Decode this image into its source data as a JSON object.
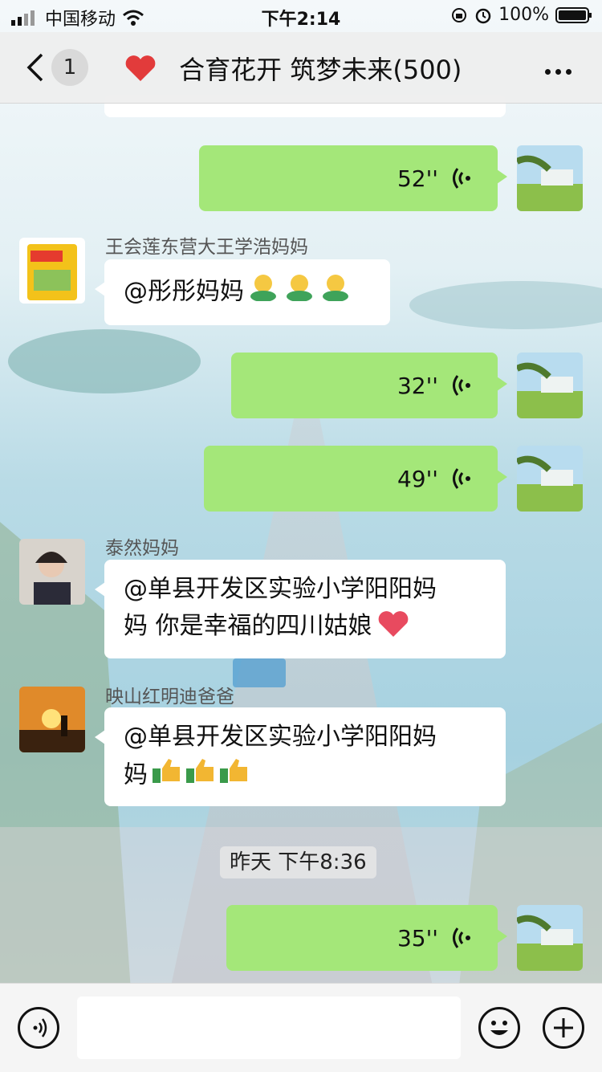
{
  "status_bar": {
    "carrier": "中国移动",
    "time": "下午2:14",
    "battery": "100%"
  },
  "header": {
    "unread_count": "1",
    "group_title": "合育花开 筑梦未来(500)"
  },
  "messages": [
    {
      "type": "voice",
      "side": "right",
      "duration": "52''"
    },
    {
      "type": "text",
      "side": "left",
      "sender": "王会莲东营大王学浩妈妈",
      "text": "@彤彤妈妈"
    },
    {
      "type": "voice",
      "side": "right",
      "duration": "32''"
    },
    {
      "type": "voice",
      "side": "right",
      "duration": "49''"
    },
    {
      "type": "text",
      "side": "left",
      "sender": "泰然妈妈",
      "line1": "@单县开发区实验小学阳阳妈",
      "line2": "妈 你是幸福的四川姑娘"
    },
    {
      "type": "text",
      "side": "left",
      "sender": "映山红明迪爸爸",
      "line1": "@单县开发区实验小学阳阳妈",
      "line2": "妈"
    },
    {
      "type": "time",
      "text": "昨天 下午8:36"
    },
    {
      "type": "voice",
      "side": "right",
      "duration": "35''"
    }
  ],
  "colors": {
    "bubble_green": "#a4e779",
    "bubble_white": "#ffffff",
    "heart": "#e23b3b"
  },
  "icons": [
    "back-chevron-icon",
    "heart-icon",
    "more-icon",
    "voice-wave-icon",
    "voice-mode-icon",
    "emoji-icon",
    "plus-icon",
    "wifi-icon",
    "signal-icon",
    "battery-icon",
    "alarm-icon",
    "rotation-lock-icon"
  ]
}
